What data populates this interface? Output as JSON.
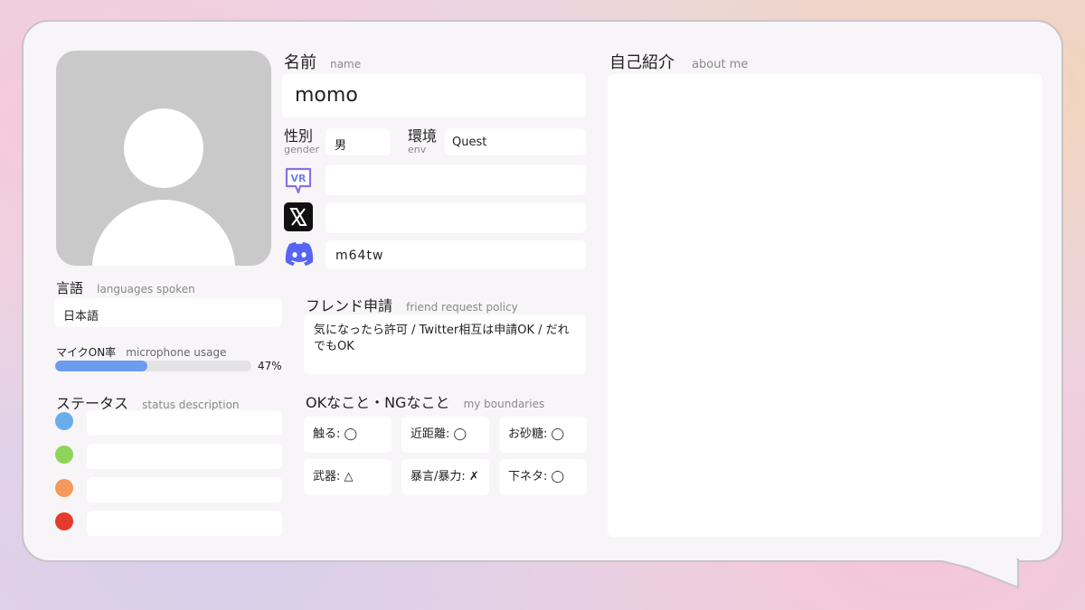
{
  "name": {
    "label_jp": "名前",
    "label_en": "name",
    "value": "momo"
  },
  "gender": {
    "label_jp": "性別",
    "label_en": "gender",
    "value": "男"
  },
  "env": {
    "label_jp": "環境",
    "label_en": "env",
    "value": "Quest"
  },
  "links": {
    "vrchat_icon": "vrchat-icon",
    "vrchat_value": "",
    "x_icon": "x-logo-icon",
    "x_value": "",
    "discord_icon": "discord-icon",
    "discord_value": "m64tw"
  },
  "languages": {
    "label_jp": "言語",
    "label_en": "languages spoken",
    "value": "日本語"
  },
  "mic": {
    "label_jp": "マイクON率",
    "label_en": "microphone usage",
    "percent": 47,
    "percent_text": "47%"
  },
  "status": {
    "label_jp": "ステータス",
    "label_en": "status description",
    "items": [
      {
        "color": "#6aaee9",
        "text": ""
      },
      {
        "color": "#8fd45a",
        "text": ""
      },
      {
        "color": "#f39a5a",
        "text": ""
      },
      {
        "color": "#e73a2e",
        "text": ""
      }
    ]
  },
  "friend": {
    "label_jp": "フレンド申請",
    "label_en": "friend request policy",
    "value": "気になったら許可 / Twitter相互は申請OK / だれでもOK"
  },
  "boundaries": {
    "label_jp": "OKなこと・NGなこと",
    "label_en": "my boundaries",
    "items": [
      "触る: ◯",
      "近距離: ◯",
      "お砂糖: ◯",
      "武器: △",
      "暴言/暴力: ✗",
      "下ネタ: ◯"
    ]
  },
  "about": {
    "label_jp": "自己紹介",
    "label_en": "about me",
    "value": ""
  },
  "colors": {
    "mic_bar": "#6b9cef",
    "mic_track": "#e3e3e6",
    "discord": "#5865f2"
  }
}
